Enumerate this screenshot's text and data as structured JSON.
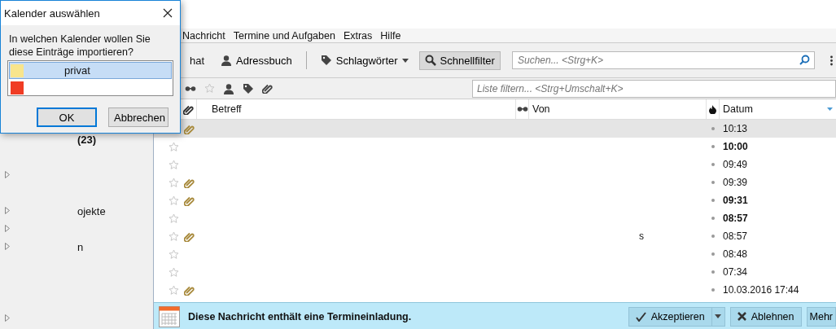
{
  "menu": [
    {
      "label": "Nachricht"
    },
    {
      "label": "Termine und Aufgaben"
    },
    {
      "label": "Extras"
    },
    {
      "label": "Hilfe"
    }
  ],
  "toolbar": {
    "cut_label": "hat",
    "address_book": "Adressbuch",
    "tags": "Schlagwörter",
    "quick_filter": {
      "label": "Schnellfilter",
      "selected": true
    },
    "search": {
      "placeholder": "Suchen... <Strg+K>"
    }
  },
  "filter_bar": {
    "placeholder": "Liste filtern... <Strg+Umschalt+K>"
  },
  "folders": [
    {
      "label": "(23)",
      "bold": true,
      "twisty": false
    },
    {
      "twisty": false
    },
    {
      "twisty": true
    },
    {
      "twisty": false
    },
    {
      "label": "ojekte",
      "bold": false,
      "twisty": true
    },
    {
      "twisty": true
    },
    {
      "label": "n",
      "bold": false,
      "twisty": true
    },
    {
      "twisty": false
    },
    {
      "twisty": false
    },
    {
      "twisty": false
    },
    {
      "twisty": true
    }
  ],
  "table": {
    "columns": [
      "Betreff",
      "Von",
      "Datum"
    ],
    "rows": [
      {
        "date": "10:13",
        "unread": false,
        "attachment": true,
        "selected": true
      },
      {
        "date": "10:00",
        "unread": true,
        "attachment": false,
        "selected": false
      },
      {
        "date": "09:49",
        "unread": false,
        "attachment": false,
        "selected": false
      },
      {
        "date": "09:39",
        "unread": false,
        "attachment": true,
        "selected": false
      },
      {
        "date": "09:31",
        "unread": true,
        "attachment": true,
        "selected": false
      },
      {
        "date": "08:57",
        "unread": true,
        "attachment": false,
        "selected": false
      },
      {
        "date": "08:57",
        "unread": false,
        "attachment": true,
        "selected": false,
        "from": "s"
      },
      {
        "date": "08:48",
        "unread": false,
        "attachment": false,
        "selected": false
      },
      {
        "date": "07:34",
        "unread": false,
        "attachment": false,
        "selected": false
      },
      {
        "date": "10.03.2016 17:44",
        "unread": false,
        "attachment": true,
        "selected": false
      }
    ]
  },
  "notification": {
    "text": "Diese Nachricht enthält eine Termineinladung.",
    "buttons": [
      {
        "label": "Akzeptieren",
        "kind": "accept"
      },
      {
        "label": "Ablehnen",
        "kind": "decline"
      },
      {
        "label": "Mehr",
        "kind": "more"
      }
    ]
  },
  "dialog": {
    "title": "Kalender auswählen",
    "question": "In welchen Kalender wollen Sie diese Einträge importieren?",
    "calendars": [
      {
        "label": "privat",
        "color": "#f8e58c",
        "selected": true
      },
      {
        "color": "#f03c24",
        "selected": false
      }
    ],
    "buttons": [
      {
        "label": "OK",
        "default": true
      },
      {
        "label": "Abbrechen",
        "default": false
      }
    ]
  }
}
